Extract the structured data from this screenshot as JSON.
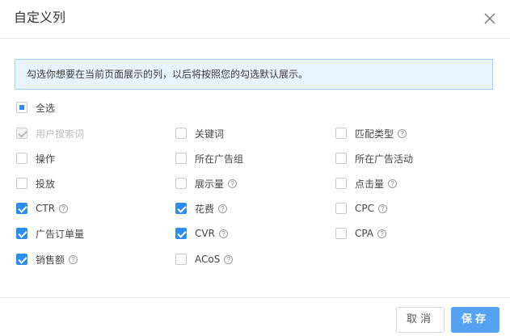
{
  "dialog": {
    "title": "自定义列",
    "close_icon": "close-icon",
    "notice": "勾选你想要在当前页面展示的列，以后将按照您的勾选默认展示。",
    "select_all": {
      "label": "全选",
      "state": "indeterminate"
    },
    "columns": [
      {
        "label": "用户搜索词",
        "state": "disabled-checked",
        "help": false
      },
      {
        "label": "关键词",
        "state": "unchecked",
        "help": false
      },
      {
        "label": "匹配类型",
        "state": "unchecked",
        "help": true
      },
      {
        "label": "操作",
        "state": "unchecked",
        "help": false
      },
      {
        "label": "所在广告组",
        "state": "unchecked",
        "help": false
      },
      {
        "label": "所在广告活动",
        "state": "unchecked",
        "help": false
      },
      {
        "label": "投放",
        "state": "unchecked",
        "help": false
      },
      {
        "label": "展示量",
        "state": "unchecked",
        "help": true
      },
      {
        "label": "点击量",
        "state": "unchecked",
        "help": true
      },
      {
        "label": "CTR",
        "state": "checked",
        "help": true
      },
      {
        "label": "花费",
        "state": "checked",
        "help": true
      },
      {
        "label": "CPC",
        "state": "unchecked",
        "help": true
      },
      {
        "label": "广告订单量",
        "state": "checked",
        "help": false
      },
      {
        "label": "CVR",
        "state": "checked",
        "help": true
      },
      {
        "label": "CPA",
        "state": "unchecked",
        "help": true
      },
      {
        "label": "销售额",
        "state": "checked",
        "help": true
      },
      {
        "label": "ACoS",
        "state": "unchecked",
        "help": true
      }
    ],
    "help_glyph": "?",
    "cancel_label": "取消",
    "save_label": "保存"
  },
  "colors": {
    "accent": "#2d8cf0",
    "save_button": "#57a3f3",
    "notice_bg": "#e8f4fd",
    "notice_border": "#9fd3f5"
  }
}
